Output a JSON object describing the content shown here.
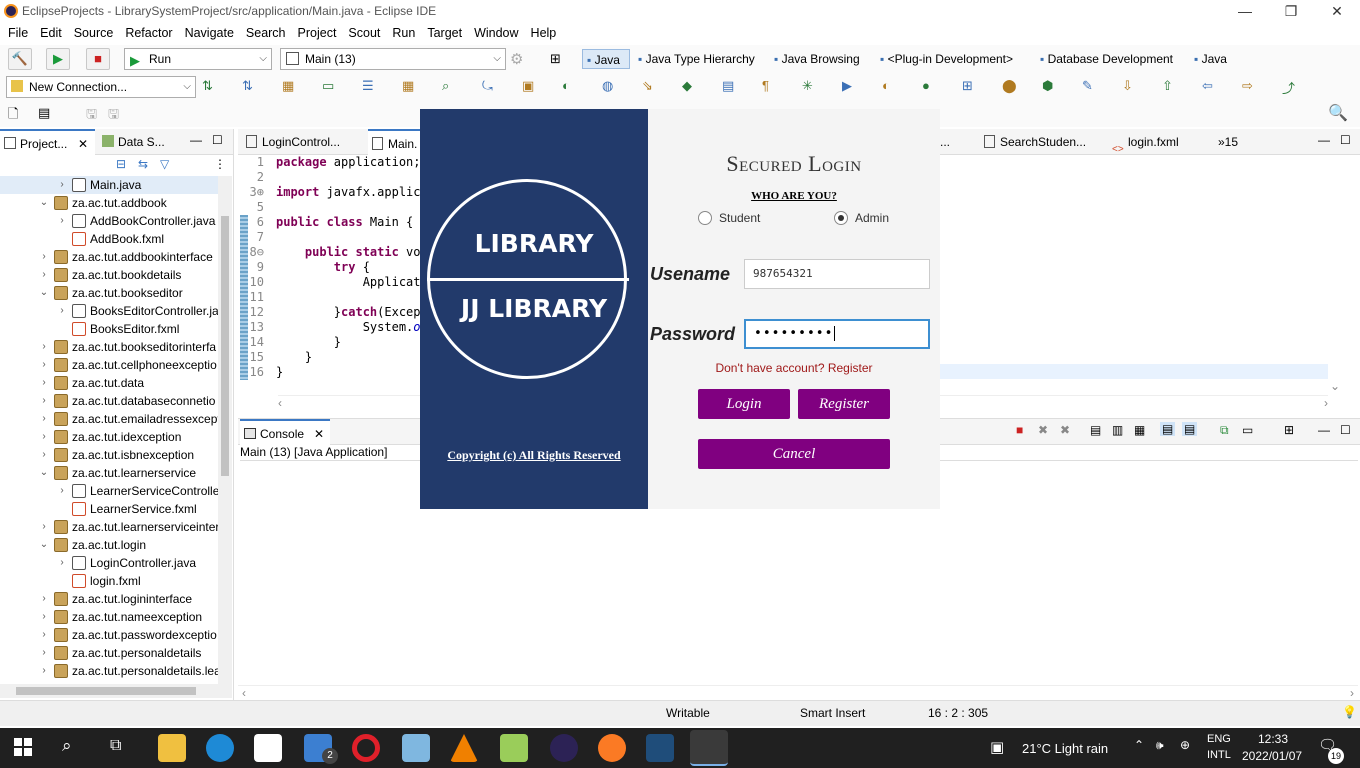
{
  "window": {
    "title": "EclipseProjects - LibrarySystemProject/src/application/Main.java - Eclipse IDE"
  },
  "menu": [
    "File",
    "Edit",
    "Source",
    "Refactor",
    "Navigate",
    "Search",
    "Project",
    "Scout",
    "Run",
    "Target",
    "Window",
    "Help"
  ],
  "toolbar": {
    "run_combo": "Run",
    "config_combo": "Main (13)",
    "connection_combo": "New Connection..."
  },
  "perspectives": [
    "Java",
    "Java Type Hierarchy",
    "Java Browsing",
    "<Plug-in Development>",
    "Database Development",
    "Java EE"
  ],
  "left_tabs": [
    "Project...",
    "Data S..."
  ],
  "tree": [
    {
      "label": "Main.java",
      "type": "java",
      "indent": 1,
      "twisty": "›",
      "selected": true
    },
    {
      "label": "za.ac.tut.addbook",
      "type": "pkg",
      "indent": 0,
      "twisty": "⌄"
    },
    {
      "label": "AddBookController.java",
      "type": "java",
      "indent": 1,
      "twisty": "›"
    },
    {
      "label": "AddBook.fxml",
      "type": "fxml",
      "indent": 1,
      "twisty": ""
    },
    {
      "label": "za.ac.tut.addbookinterface",
      "type": "pkg",
      "indent": 0,
      "twisty": "›"
    },
    {
      "label": "za.ac.tut.bookdetails",
      "type": "pkg",
      "indent": 0,
      "twisty": "›"
    },
    {
      "label": "za.ac.tut.bookseditor",
      "type": "pkg",
      "indent": 0,
      "twisty": "⌄"
    },
    {
      "label": "BooksEditorController.ja",
      "type": "java",
      "indent": 1,
      "twisty": "›"
    },
    {
      "label": "BooksEditor.fxml",
      "type": "fxml",
      "indent": 1,
      "twisty": ""
    },
    {
      "label": "za.ac.tut.bookseditorinterfa",
      "type": "pkg",
      "indent": 0,
      "twisty": "›"
    },
    {
      "label": "za.ac.tut.cellphoneexceptio",
      "type": "pkg",
      "indent": 0,
      "twisty": "›"
    },
    {
      "label": "za.ac.tut.data",
      "type": "pkg",
      "indent": 0,
      "twisty": "›"
    },
    {
      "label": "za.ac.tut.databaseconnetio",
      "type": "pkg",
      "indent": 0,
      "twisty": "›"
    },
    {
      "label": "za.ac.tut.emailadressexcept",
      "type": "pkg",
      "indent": 0,
      "twisty": "›"
    },
    {
      "label": "za.ac.tut.idexception",
      "type": "pkg",
      "indent": 0,
      "twisty": "›"
    },
    {
      "label": "za.ac.tut.isbnexception",
      "type": "pkg",
      "indent": 0,
      "twisty": "›"
    },
    {
      "label": "za.ac.tut.learnerservice",
      "type": "pkg",
      "indent": 0,
      "twisty": "⌄"
    },
    {
      "label": "LearnerServiceController",
      "type": "java",
      "indent": 1,
      "twisty": "›"
    },
    {
      "label": "LearnerService.fxml",
      "type": "fxml",
      "indent": 1,
      "twisty": ""
    },
    {
      "label": "za.ac.tut.learnerserviceinter",
      "type": "pkg",
      "indent": 0,
      "twisty": "›"
    },
    {
      "label": "za.ac.tut.login",
      "type": "pkg",
      "indent": 0,
      "twisty": "⌄"
    },
    {
      "label": "LoginController.java",
      "type": "java",
      "indent": 1,
      "twisty": "›"
    },
    {
      "label": "login.fxml",
      "type": "fxml",
      "indent": 1,
      "twisty": ""
    },
    {
      "label": "za.ac.tut.logininterface",
      "type": "pkg",
      "indent": 0,
      "twisty": "›"
    },
    {
      "label": "za.ac.tut.nameexception",
      "type": "pkg",
      "indent": 0,
      "twisty": "›"
    },
    {
      "label": "za.ac.tut.passwordexceptio",
      "type": "pkg",
      "indent": 0,
      "twisty": "›"
    },
    {
      "label": "za.ac.tut.personaldetails",
      "type": "pkg",
      "indent": 0,
      "twisty": "›"
    },
    {
      "label": "za.ac.tut.personaldetails.lea",
      "type": "pkg",
      "indent": 0,
      "twisty": "›"
    }
  ],
  "editor_tabs": {
    "tab1": "LoginControl...",
    "tab2": "Main.",
    "tab3": "...",
    "tab4": "SearchStuden...",
    "tab5": "login.fxml",
    "overflow": "»15"
  },
  "code": [
    {
      "n": "1",
      "html": "<span class=\"kw\">package</span> application;"
    },
    {
      "n": "2",
      "html": ""
    },
    {
      "n": "3⊕",
      "html": "<span class=\"kw\">import</span> javafx.applica"
    },
    {
      "n": "5",
      "html": ""
    },
    {
      "n": "6",
      "html": "<span class=\"kw\">public class</span> Main {"
    },
    {
      "n": "7",
      "html": ""
    },
    {
      "n": "8⊖",
      "html": "    <span class=\"kw\">public static</span> voi"
    },
    {
      "n": "9",
      "html": "        <span class=\"kw\">try</span> {"
    },
    {
      "n": "10",
      "html": "            Applicat"
    },
    {
      "n": "11",
      "html": ""
    },
    {
      "n": "12",
      "html": "        }<span class=\"kw\">catch</span>(Except"
    },
    {
      "n": "13",
      "html": "            System.<i style=\"color:#0000c0\">ou</i>"
    },
    {
      "n": "14",
      "html": "        }"
    },
    {
      "n": "15",
      "html": "    }"
    },
    {
      "n": "16",
      "html": "}"
    }
  ],
  "console": {
    "tab": "Console",
    "desc": "Main (13) [Java Application]"
  },
  "status": {
    "writable": "Writable",
    "insert": "Smart Insert",
    "pos": "16 : 2 : 305"
  },
  "dialog": {
    "logo_top": "LIBRARY",
    "logo_bottom": "JJ LIBRARY",
    "copyright": "Copyright (c) All Rights Reserved",
    "title": "Secured Login",
    "who": "WHO ARE YOU?",
    "student": "Student",
    "admin": "Admin",
    "username_label": "Usename",
    "username_value": "987654321",
    "password_label": "Password",
    "password_value": "•••••••••",
    "register_hint": "Don't have account? Register",
    "login_btn": "Login",
    "register_btn": "Register",
    "cancel_btn": "Cancel"
  },
  "taskbar": {
    "weather": "21°C  Light rain",
    "lang1": "ENG",
    "lang2": "INTL",
    "time": "12:33",
    "date": "2022/01/07",
    "notif": "19",
    "mail_badge": "2"
  }
}
